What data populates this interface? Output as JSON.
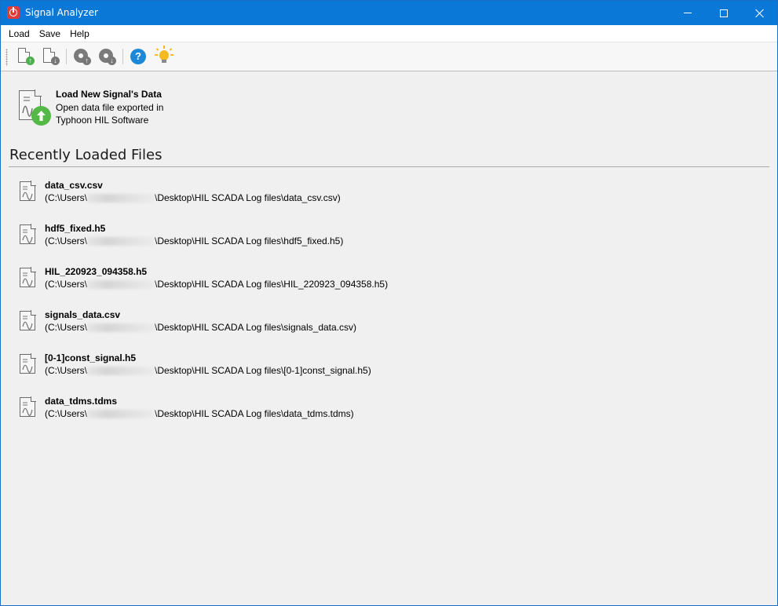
{
  "window": {
    "title": "Signal Analyzer",
    "accent_color": "#0a78d7"
  },
  "menu": {
    "items": [
      {
        "label": "Load"
      },
      {
        "label": "Save"
      },
      {
        "label": "Help"
      }
    ]
  },
  "toolbar": {
    "buttons": [
      {
        "icon": "load-file-icon"
      },
      {
        "icon": "save-file-icon"
      },
      {
        "icon": "load-settings-icon"
      },
      {
        "icon": "save-settings-icon"
      },
      {
        "icon": "help-icon"
      },
      {
        "icon": "tip-bulb-icon"
      }
    ]
  },
  "load_new": {
    "title": "Load New Signal's Data",
    "description": "Open data file exported in Typhoon HIL Software",
    "icon": "document-upload-icon"
  },
  "recent": {
    "heading": "Recently Loaded Files",
    "files": [
      {
        "name": "data_csv.csv",
        "path_prefix": "(C:\\Users\\",
        "path_suffix": "\\Desktop\\HIL SCADA Log files\\data_csv.csv)"
      },
      {
        "name": "hdf5_fixed.h5",
        "path_prefix": "(C:\\Users\\",
        "path_suffix": "\\Desktop\\HIL SCADA Log files\\hdf5_fixed.h5)"
      },
      {
        "name": "HIL_220923_094358.h5",
        "path_prefix": "(C:\\Users\\",
        "path_suffix": "\\Desktop\\HIL SCADA Log files\\HIL_220923_094358.h5)"
      },
      {
        "name": "signals_data.csv",
        "path_prefix": "(C:\\Users\\",
        "path_suffix": "\\Desktop\\HIL SCADA Log files\\signals_data.csv)"
      },
      {
        "name": "[0-1]const_signal.h5",
        "path_prefix": "(C:\\Users\\",
        "path_suffix": "\\Desktop\\HIL SCADA Log files\\[0-1]const_signal.h5)"
      },
      {
        "name": "data_tdms.tdms",
        "path_prefix": "(C:\\Users\\",
        "path_suffix": "\\Desktop\\HIL SCADA Log files\\data_tdms.tdms)"
      }
    ]
  }
}
